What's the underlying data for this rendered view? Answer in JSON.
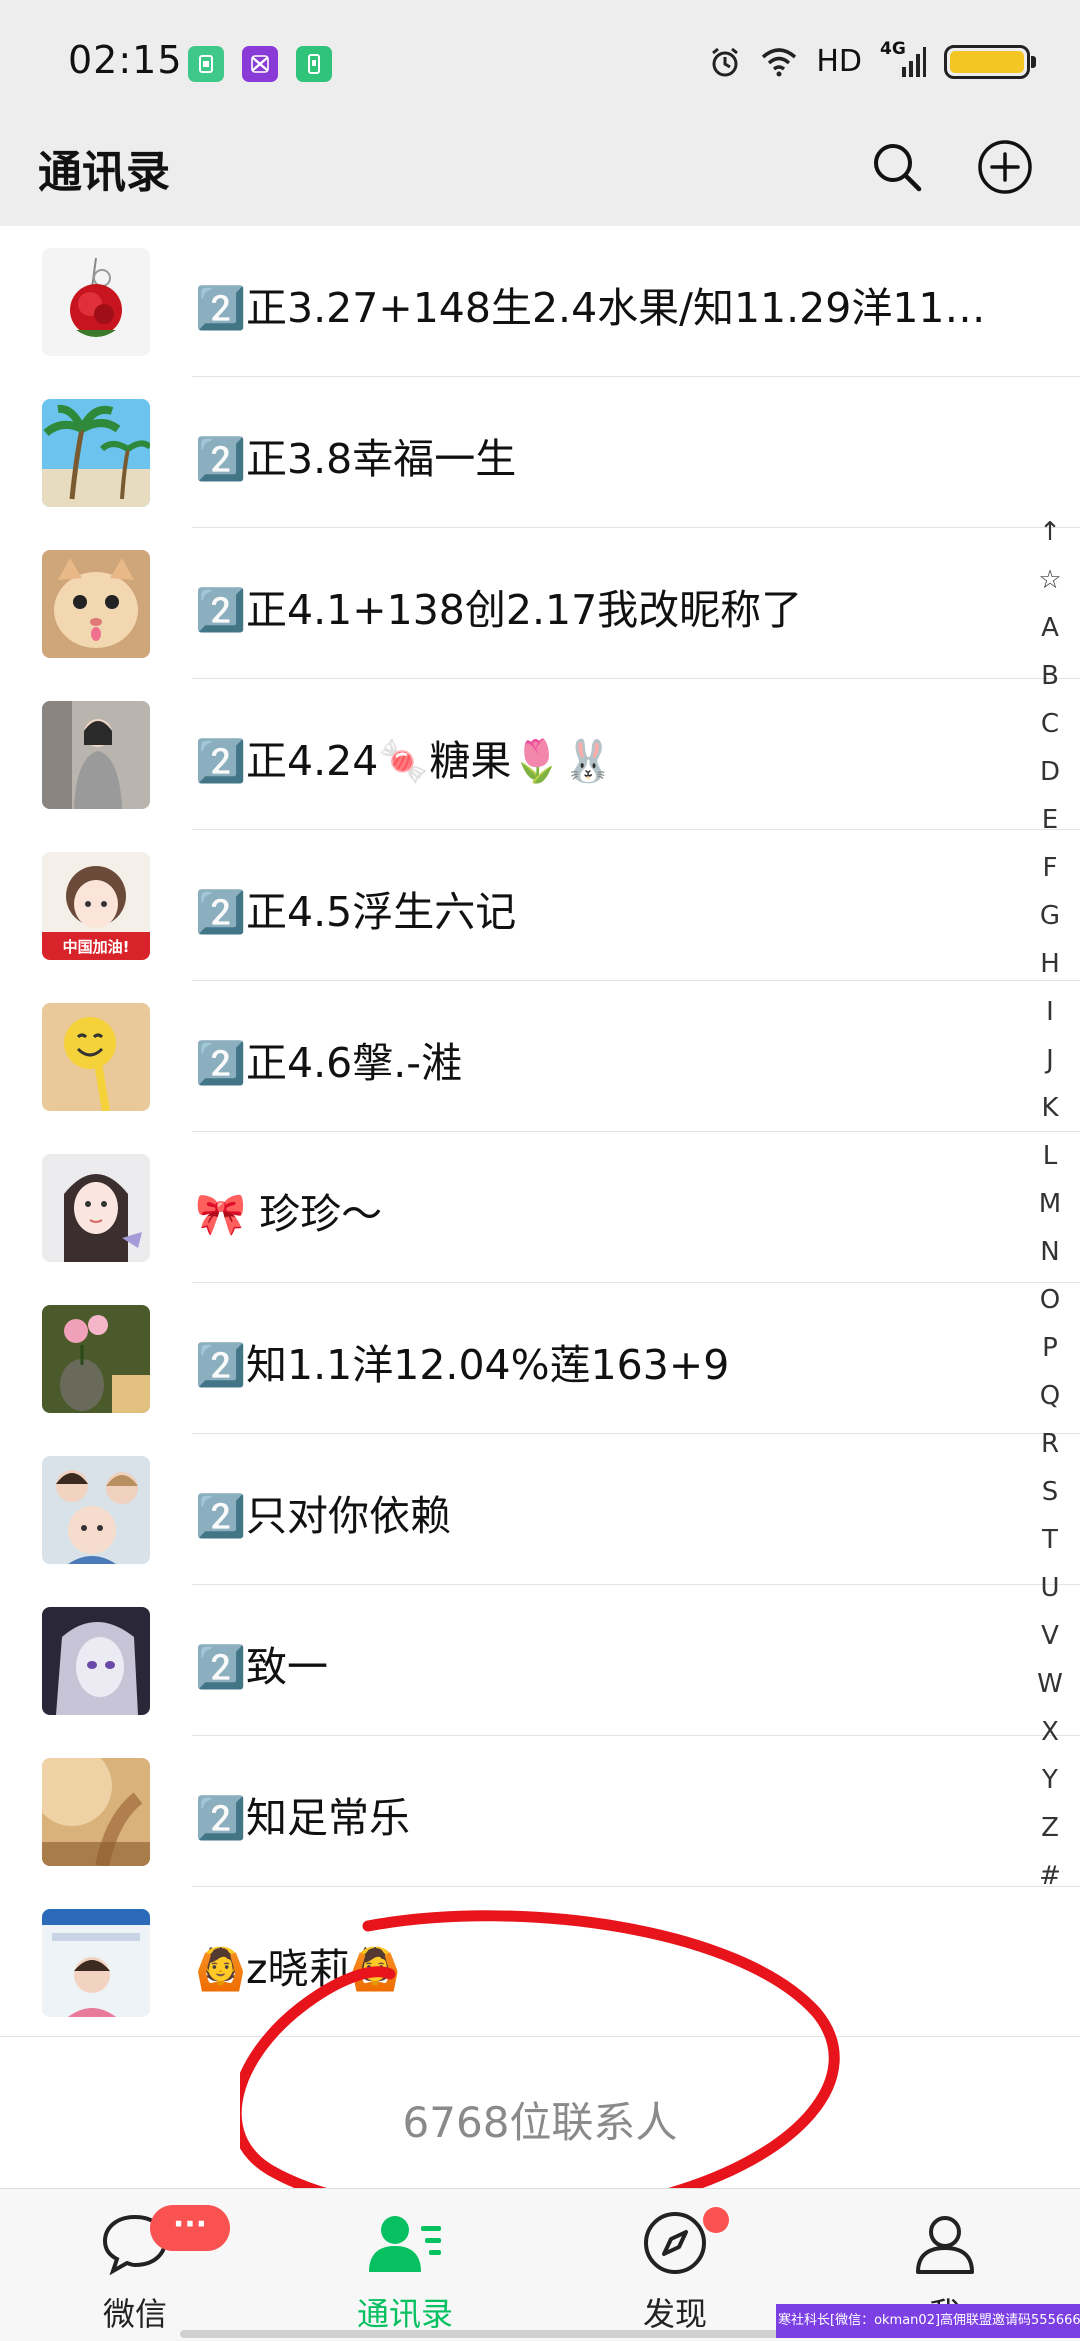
{
  "status_bar": {
    "time": "02:15",
    "network_label": "HD",
    "network_type": "4G",
    "battery_color": "#f3c623",
    "app_icons": [
      "green-sim-icon",
      "purple-app-icon",
      "green-phone-icon"
    ]
  },
  "header": {
    "title": "通讯录",
    "search_icon": "search-icon",
    "add_icon": "plus-circle-icon"
  },
  "contacts": [
    {
      "name": "2️⃣正3.27+148生2.4水果/知11.29洋11…",
      "avatar": "red-rose"
    },
    {
      "name": "2️⃣正3.8幸福一生",
      "avatar": "palm-tree-beach"
    },
    {
      "name": "2️⃣正4.1+138创2.17我改昵称了",
      "avatar": "cat"
    },
    {
      "name": "2️⃣正4.24🍬糖果🌷🐰",
      "avatar": "woman-grey-coat"
    },
    {
      "name": "2️⃣正4.5浮生六记",
      "avatar": "anime-girl-china"
    },
    {
      "name": "2️⃣正4.6搫.-溎",
      "avatar": "smiley-toy"
    },
    {
      "name": "🎀 珍珍～",
      "avatar": "girl-portrait"
    },
    {
      "name": "2️⃣知1.1洋12.04%莲163+9",
      "avatar": "lotus-vase"
    },
    {
      "name": "2️⃣只对你依赖",
      "avatar": "family-photo"
    },
    {
      "name": "2️⃣致一",
      "avatar": "anime-purple"
    },
    {
      "name": "2️⃣知足常乐",
      "avatar": "warm-blur"
    },
    {
      "name": "🙆z晓莉🙆",
      "avatar": "child-photo-card"
    }
  ],
  "alpha_index": [
    "↑",
    "☆",
    "A",
    "B",
    "C",
    "D",
    "E",
    "F",
    "G",
    "H",
    "I",
    "J",
    "K",
    "L",
    "M",
    "N",
    "O",
    "P",
    "Q",
    "R",
    "S",
    "T",
    "U",
    "V",
    "W",
    "X",
    "Y",
    "Z",
    "#"
  ],
  "footer": {
    "count_text": "6768位联系人",
    "annotation_color": "#e8141b"
  },
  "tabs": [
    {
      "label": "微信",
      "icon": "chat-bubble-icon",
      "badge": "···",
      "active": false
    },
    {
      "label": "通讯录",
      "icon": "contacts-icon",
      "active": true
    },
    {
      "label": "发现",
      "icon": "compass-icon",
      "active": false
    },
    {
      "label": "我",
      "icon": "person-icon",
      "active": false
    }
  ],
  "colors": {
    "accent": "#07c160",
    "badge": "#fa5151",
    "header_bg": "#ededed"
  },
  "watermark": "寒社科长[微信：okman02]高佣联盟邀请码555666"
}
